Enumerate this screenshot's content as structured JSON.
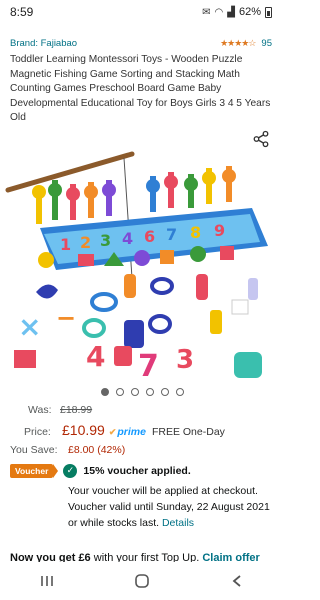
{
  "status": {
    "time": "8:59",
    "battery": "62%"
  },
  "product": {
    "brand": "Brand: Fajiabao",
    "stars": "★★★★☆",
    "rating_count": "95",
    "title": "Toddler Learning Montessori Toys - Wooden Puzzle Magnetic Fishing Game Sorting and Stacking Math Counting Games Preschool Board Game Baby Developmental Educational Toy for Boys Girls 3 4 5 Years Old",
    "image_count": 6,
    "active_image": 1
  },
  "pricing": {
    "was_label": "Was:",
    "was_value": "£18.99",
    "price_label": "Price:",
    "price_value": "£10.99",
    "prime_label": "prime",
    "delivery": "FREE One-Day",
    "save_label": "You Save:",
    "save_value": "£8.00 (42%)"
  },
  "voucher": {
    "badge": "Voucher",
    "applied": "15% voucher applied.",
    "detail": "Your voucher will be applied at checkout. Voucher valid until Sunday, 22 August 2021 or while stocks last.",
    "details_link": "Details"
  },
  "topup": {
    "prefix": "Now you get £6",
    "middle": " with your first Top Up. ",
    "claim": "Claim offer"
  },
  "colors": {
    "link": "#007185",
    "price": "#b12704",
    "prime": "#1399ff",
    "voucher_badge": "#e47911",
    "check": "#067d62"
  }
}
